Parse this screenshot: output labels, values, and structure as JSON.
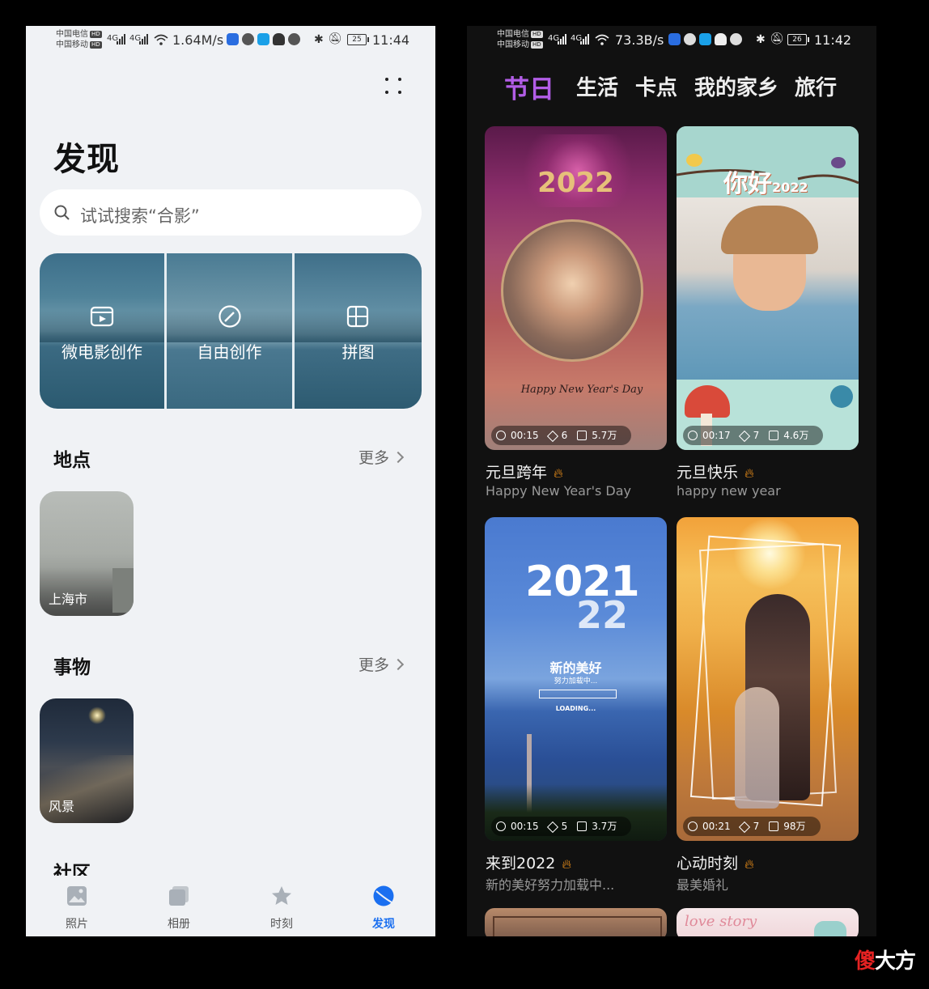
{
  "left": {
    "status": {
      "carrier1": "中国电信",
      "carrier2": "中国移动",
      "hd": "HD",
      "net": "4G",
      "speed": "1.64M/s",
      "battery": "25",
      "time": "11:44"
    },
    "title": "发现",
    "search_placeholder": "试试搜索“合影”",
    "creation_tiles": [
      {
        "label": "微电影创作",
        "icon": "movie-icon"
      },
      {
        "label": "自由创作",
        "icon": "gauge-icon"
      },
      {
        "label": "拼图",
        "icon": "collage-icon"
      }
    ],
    "places": {
      "title": "地点",
      "more": "更多",
      "card_label": "上海市"
    },
    "things": {
      "title": "事物",
      "more": "更多",
      "card_label": "风景"
    },
    "community_title": "社区",
    "tabs": [
      {
        "label": "照片",
        "icon": "photo-icon"
      },
      {
        "label": "相册",
        "icon": "album-icon"
      },
      {
        "label": "时刻",
        "icon": "star-icon"
      },
      {
        "label": "发现",
        "icon": "discover-icon"
      }
    ],
    "active_tab": "发现",
    "accent": "#1a6ff0"
  },
  "right": {
    "status": {
      "carrier1": "中国电信",
      "carrier2": "中国移动",
      "hd": "HD",
      "net": "4G",
      "speed": "73.3B/s",
      "battery": "26",
      "time": "11:42"
    },
    "categories": [
      "节日",
      "生活",
      "卡点",
      "我的家乡",
      "旅行"
    ],
    "active_category": "节日",
    "accent": "#b25de6",
    "templates": [
      {
        "title": "元旦跨年",
        "subtitle": "Happy New Year's Day",
        "duration": "00:15",
        "clips": "6",
        "uses": "5.7万",
        "overlay_year": "2022",
        "overlay_script": "Happy New Year's Day"
      },
      {
        "title": "元旦快乐",
        "subtitle": "happy new year",
        "duration": "00:17",
        "clips": "7",
        "uses": "4.6万",
        "overlay_text": "你好",
        "overlay_year": "2022"
      },
      {
        "title": "来到2022",
        "subtitle": "新的美好努力加载中...",
        "duration": "00:15",
        "clips": "5",
        "uses": "3.7万",
        "overlay_top": "2021",
        "overlay_bottom": "22",
        "overlay_main": "新的美好",
        "overlay_sub": "努力加载中...",
        "overlay_loading": "LOADING..."
      },
      {
        "title": "心动时刻",
        "subtitle": "最美婚礼",
        "duration": "00:21",
        "clips": "7",
        "uses": "98万"
      }
    ],
    "partial_card_text": "love story"
  },
  "watermark": {
    "part1": "傻",
    "part2": "大方"
  }
}
